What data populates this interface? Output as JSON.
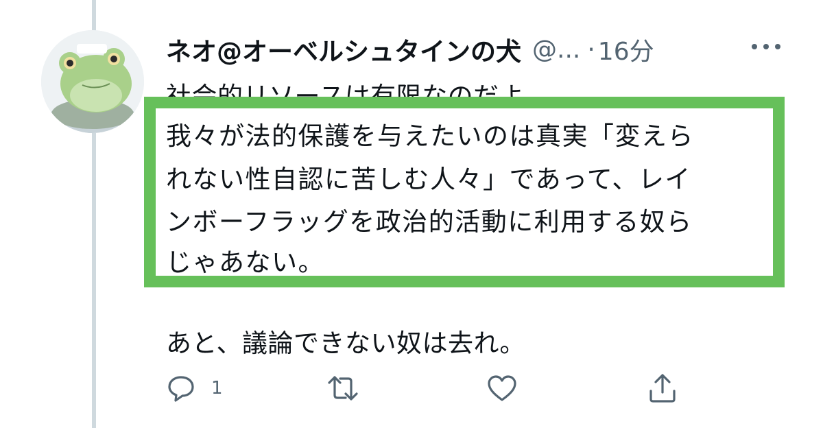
{
  "tweet": {
    "display_name": "ネオ@オーベルシュタインの犬",
    "handle": "@...",
    "separator": "·",
    "time": "16分",
    "line1": "社会的リソースは有限なのだよ。",
    "quote_lines": [
      "我々が法的保護を与えたいのは真実「変えら",
      "れない性自認に苦しむ人々」であって、レイ",
      "ンボーフラッグを政治的活動に利用する奴ら",
      "じゃあない。"
    ],
    "line2": "あと、議論できない奴は去れ。"
  },
  "actions": {
    "reply_count": "1",
    "icons": [
      "reply-icon",
      "retweet-icon",
      "like-icon",
      "share-icon"
    ]
  },
  "colors": {
    "highlight": "#66c05a",
    "muted": "#536471",
    "thread_line": "#cfd9de"
  }
}
